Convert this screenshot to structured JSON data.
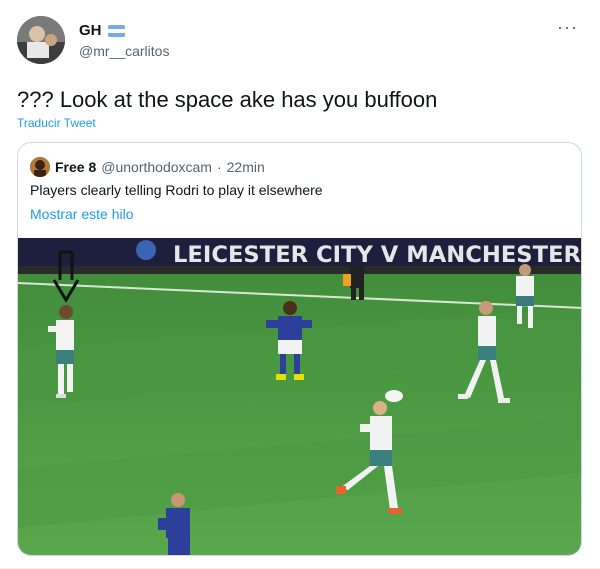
{
  "tweet": {
    "display_name": "GH",
    "handle": "@mr__carlitos",
    "more_label": "···",
    "text": "??? Look at the space ake has you buffoon",
    "translate_label": "Traducir Tweet",
    "flag_colors": [
      "#74acdf",
      "#ffffff",
      "#74acdf"
    ]
  },
  "quote": {
    "display_name": "Free 8",
    "handle": "@unorthodoxcam",
    "separator": "·",
    "time": "22min",
    "text": "Players clearly telling Rodri to play it elsewhere",
    "show_thread_label": "Mostrar este hilo"
  },
  "media": {
    "banner_text": "LEICESTER CITY V MANCHESTER",
    "pitch_color": "#4f9a46"
  }
}
